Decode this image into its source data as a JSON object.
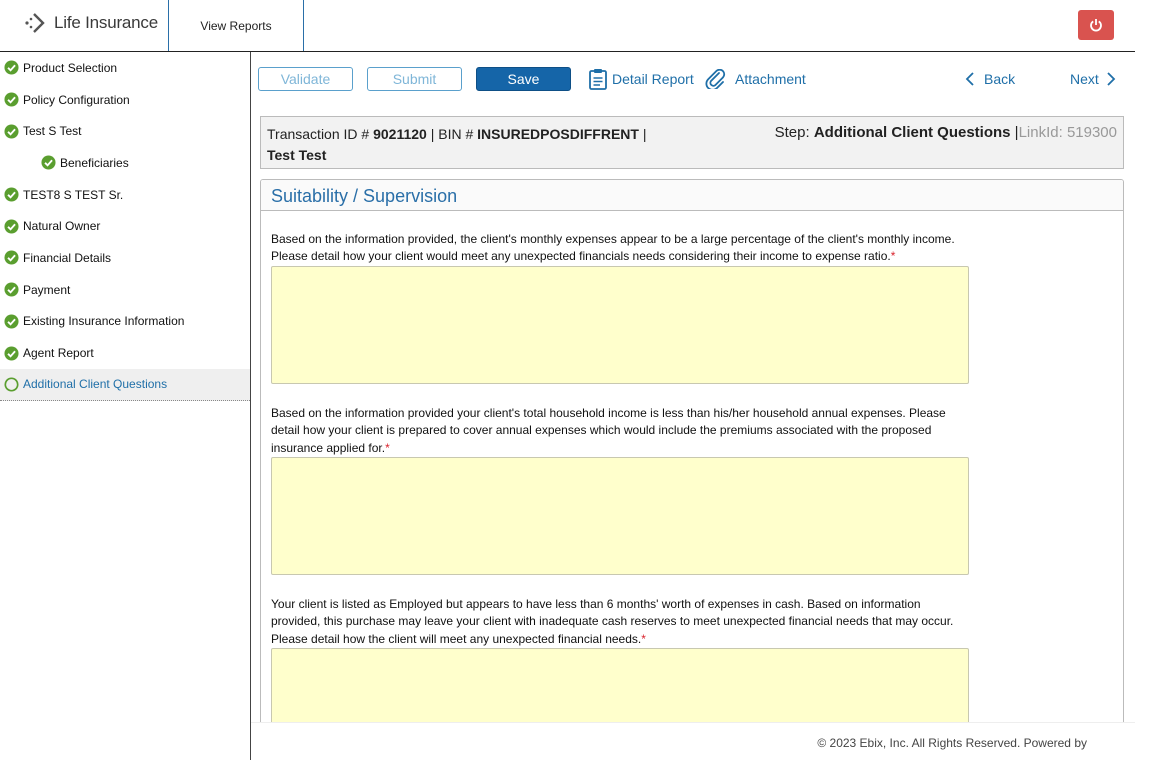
{
  "header": {
    "app_name": "Life Insurance",
    "view_reports": "View Reports"
  },
  "sidebar": {
    "items": [
      {
        "label": "Product Selection"
      },
      {
        "label": "Policy Configuration"
      },
      {
        "label": "Test S Test"
      },
      {
        "label": "Beneficiaries"
      },
      {
        "label": "TEST8 S TEST Sr."
      },
      {
        "label": "Natural Owner"
      },
      {
        "label": "Financial Details"
      },
      {
        "label": "Payment"
      },
      {
        "label": "Existing Insurance Information"
      },
      {
        "label": "Agent Report"
      },
      {
        "label": "Additional Client Questions"
      }
    ]
  },
  "toolbar": {
    "validate": "Validate",
    "submit": "Submit",
    "save": "Save",
    "detail_report": "Detail Report",
    "attachment": "Attachment",
    "back": "Back",
    "next": "Next"
  },
  "transaction": {
    "txid_label": "Transaction ID #",
    "txid": "9021120",
    "bin_label": "| BIN #",
    "bin": "INSUREDPOSDIFFRENT",
    "sep": "|",
    "name": "Test Test",
    "step_label": "Step:",
    "step": "Additional Client Questions",
    "link_sep": "|",
    "link_label": "LinkId: 519300"
  },
  "panel": {
    "title": "Suitability / Supervision",
    "questions": [
      {
        "text": "Based on the information provided, the client's monthly expenses appear to be a large percentage of the client's monthly income. Please detail how your client would meet any unexpected financials needs considering their income to expense ratio.",
        "required": "*",
        "value": ""
      },
      {
        "text": "Based on the information provided your client's total household income is less than his/her household annual expenses. Please detail how your client is prepared to cover annual expenses which would include the premiums associated with the proposed insurance applied for.",
        "required": "*",
        "value": ""
      },
      {
        "text": "Your client is listed as Employed but appears to have less than 6 months' worth of expenses in cash. Based on information provided, this purchase may leave your client with inadequate cash reserves to meet unexpected financial needs that may occur. Please detail how the client will meet any unexpected financial needs.",
        "required": "*",
        "value": ""
      }
    ]
  },
  "footer": {
    "text": "© 2023 Ebix, Inc. All Rights Reserved. Powered by"
  },
  "colors": {
    "accent": "#1f6fa8",
    "save_bg": "#1565a8",
    "power_bg": "#d9534f",
    "check_green": "#5a9e2f",
    "textarea_bg": "#ffffcc"
  }
}
